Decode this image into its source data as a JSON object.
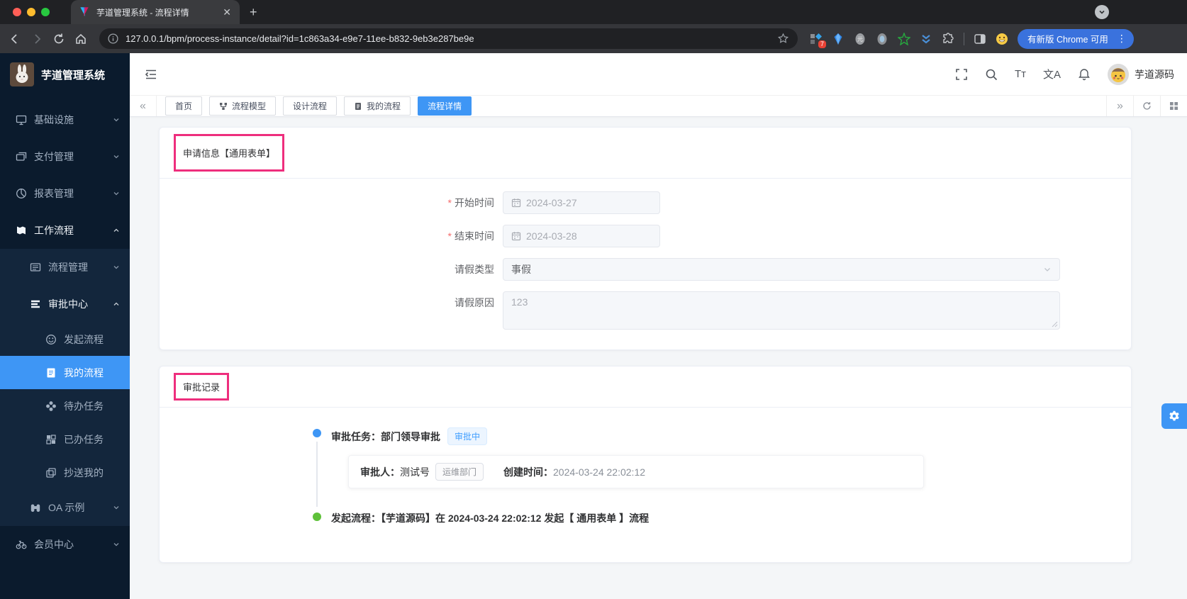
{
  "browser": {
    "tab_title": "芋道管理系统 - 流程详情",
    "url": "127.0.0.1/bpm/process-instance/detail?id=1c863a34-e9e7-11ee-b832-9eb3e287be9e",
    "extension_badge": "7",
    "update_button_label": "有新版 Chrome 可用"
  },
  "header": {
    "logo_title": "芋道管理系统",
    "username": "芋道源码",
    "font_size_icon_text": "Tт",
    "locale_icon_text": "文A"
  },
  "sidebar": {
    "items": [
      {
        "label": "基础设施"
      },
      {
        "label": "支付管理"
      },
      {
        "label": "报表管理"
      },
      {
        "label": "工作流程"
      },
      {
        "label": "流程管理"
      },
      {
        "label": "审批中心"
      },
      {
        "label": "发起流程"
      },
      {
        "label": "我的流程"
      },
      {
        "label": "待办任务"
      },
      {
        "label": "已办任务"
      },
      {
        "label": "抄送我的"
      },
      {
        "label": "OA 示例"
      },
      {
        "label": "会员中心"
      }
    ]
  },
  "tagsbar": {
    "tabs": [
      {
        "label": "首页"
      },
      {
        "label": "流程模型"
      },
      {
        "label": "设计流程"
      },
      {
        "label": "我的流程"
      },
      {
        "label": "流程详情"
      }
    ]
  },
  "form_card": {
    "title": "申请信息【通用表单】",
    "fields": {
      "start": {
        "label": "开始时间",
        "value": "2024-03-27"
      },
      "end": {
        "label": "结束时间",
        "value": "2024-03-28"
      },
      "type": {
        "label": "请假类型",
        "value": "事假"
      },
      "reason": {
        "label": "请假原因",
        "value": "123"
      }
    }
  },
  "record_card": {
    "title": "审批记录",
    "task": {
      "title": "审批任务：部门领导审批",
      "status": "审批中",
      "approver_label": "审批人：",
      "approver": "测试号",
      "dept": "运维部门",
      "created_label": "创建时间：",
      "created": "2024-03-24 22:02:12"
    },
    "start_event": "发起流程：【芋道源码】在 2024-03-24 22:02:12 发起【 通用表单 】流程"
  },
  "colors": {
    "primary": "#3e96f5",
    "annotation": "#ee2e7d",
    "success": "#5fc13a"
  }
}
